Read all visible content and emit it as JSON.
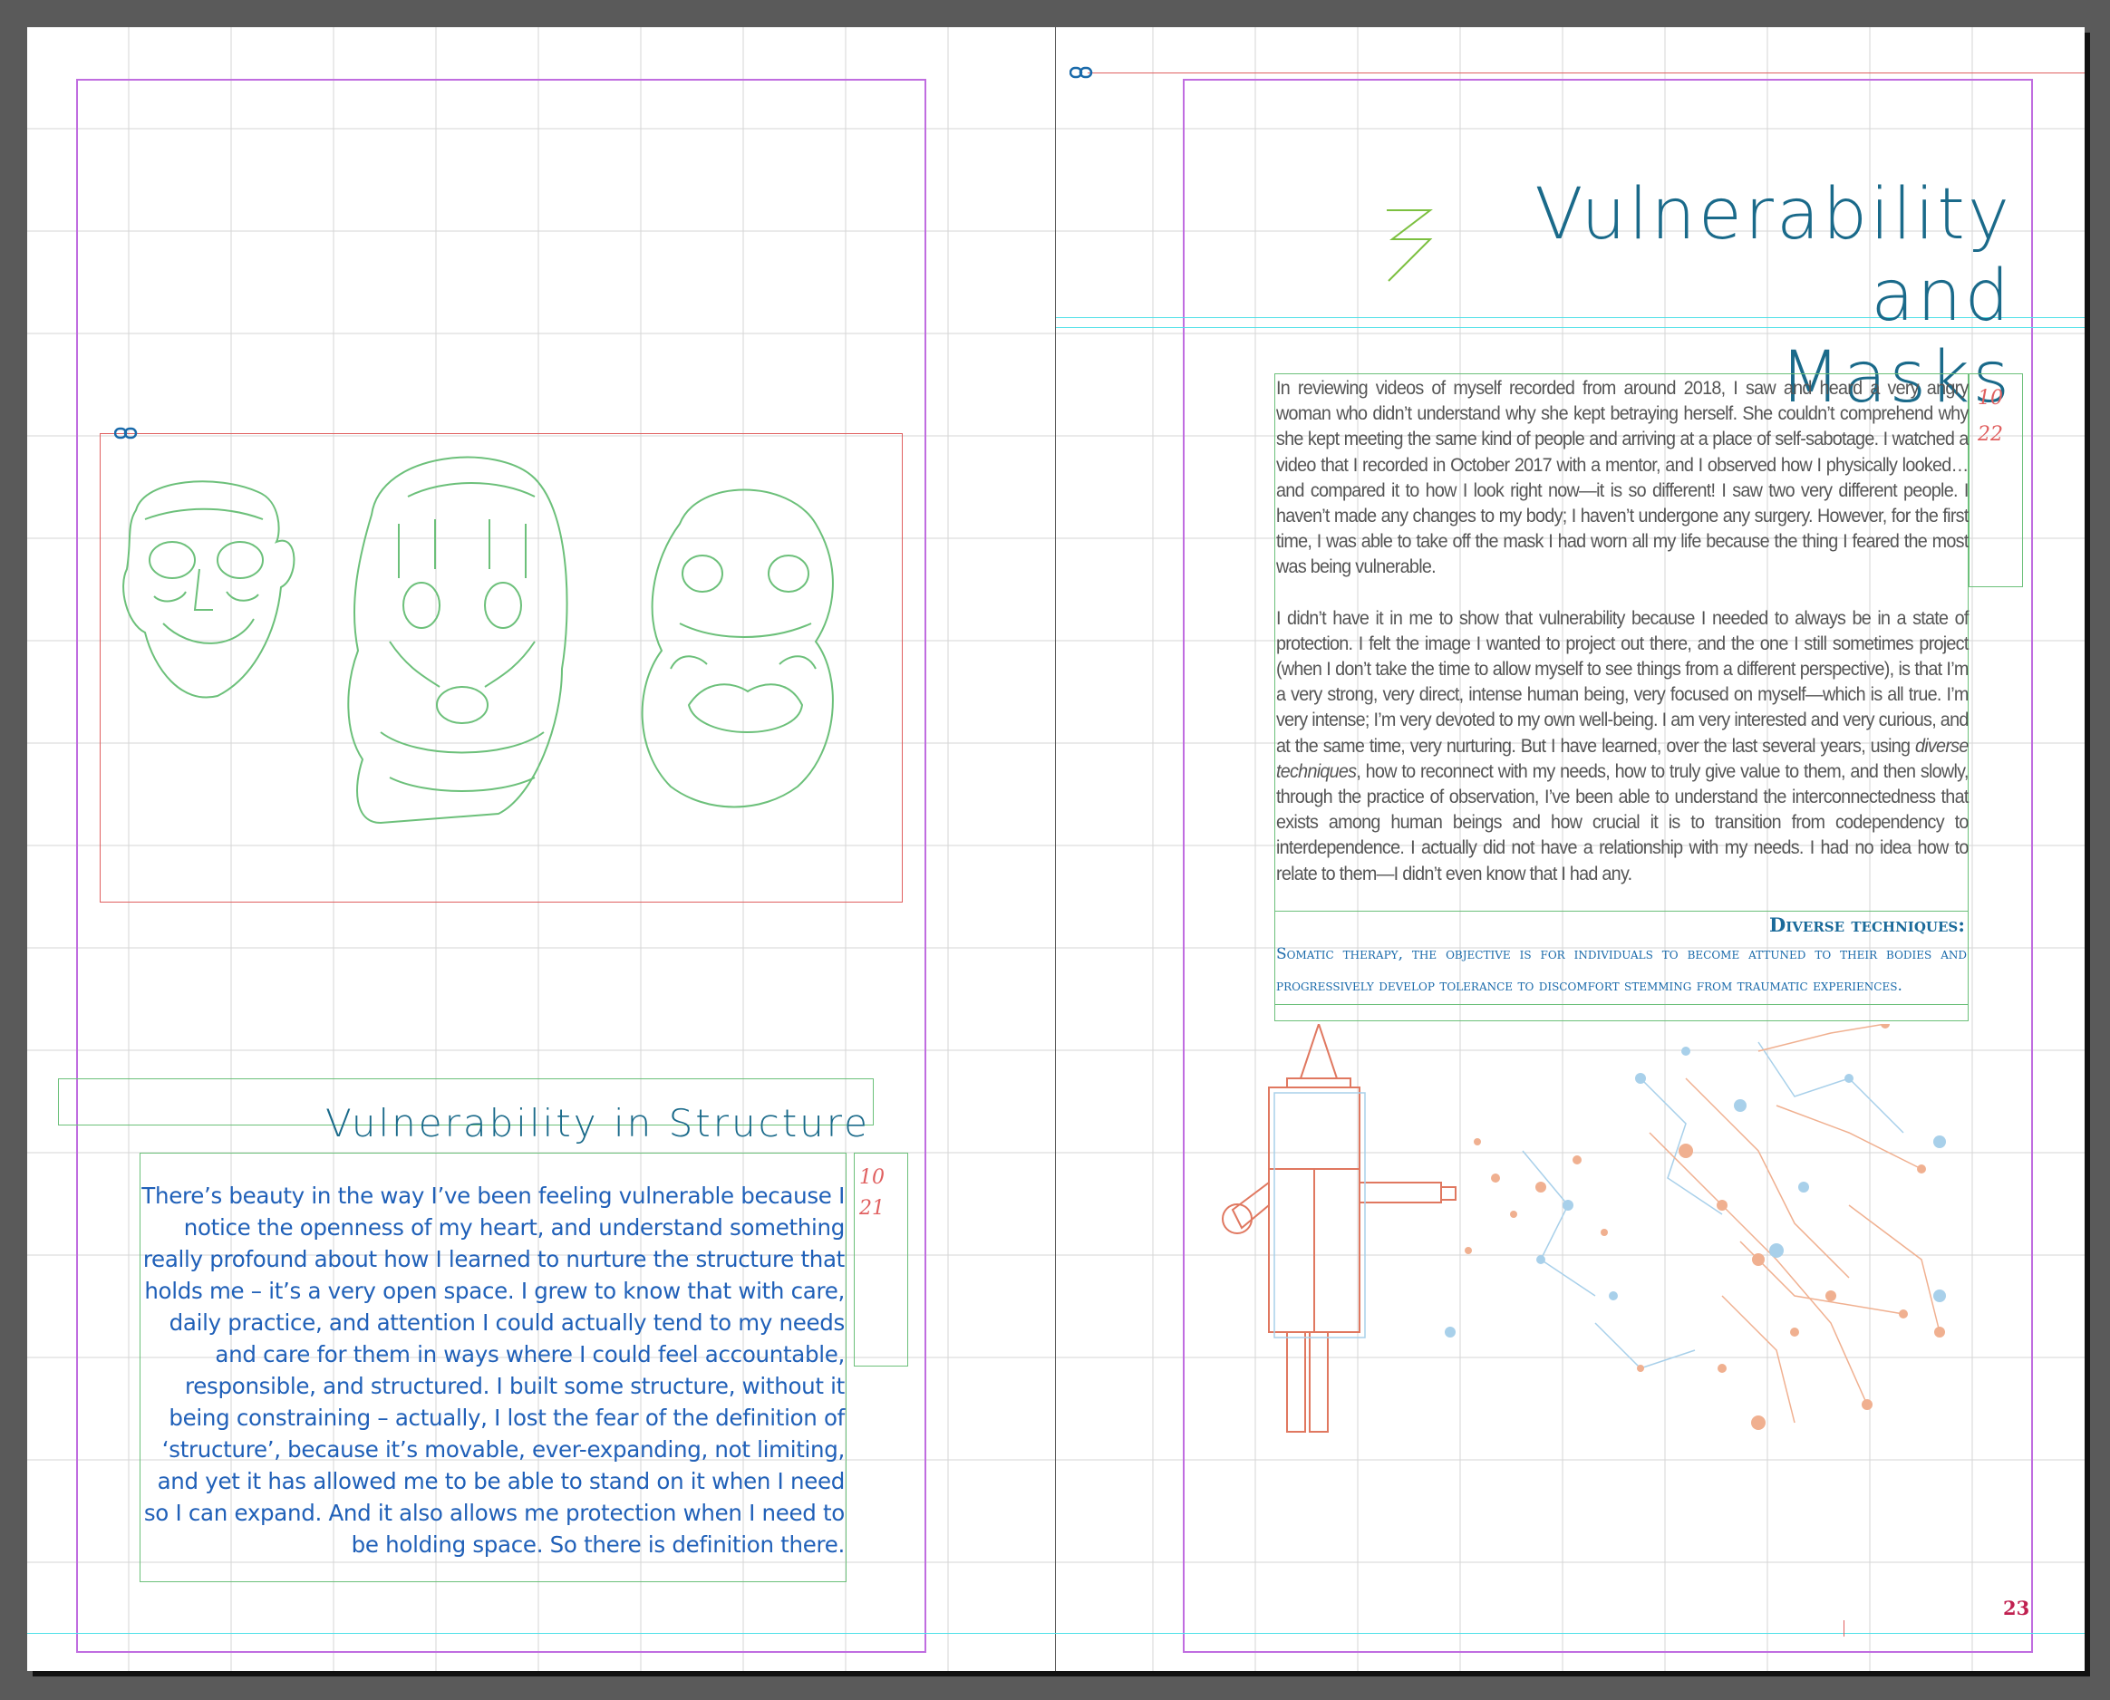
{
  "left_page": {
    "section_heading": "Vulnerability in Structure",
    "body_text": "There’s  beauty in the  way I’ve been feeling vulnerable because I notice the openness of my heart, and understand something really profound about how I learned to nurture the structure that holds me – it’s a very open space.  I grew to know that with care, daily practice, and attention I could actually tend to my needs and care for them in ways where I could feel accountable, responsible, and structured.  I built some structure, without it being constraining – actually, I lost the fear of the  definition of ‘structure’, because it’s movable, ever-expanding, not limiting, and yet it has allowed me to be able to stand on it when I need so I can expand. And it also allows me protection when I need to be holding space. So there is definition there.",
    "notes": [
      "10",
      "21"
    ],
    "image_name": "masks-illustration"
  },
  "right_page": {
    "chapter_title_line1": "Vulnerability",
    "chapter_title_line2": "and",
    "chapter_title_line3": "Masks",
    "chapter_number_glyph": "3",
    "body_paragraph1": "In reviewing videos of myself recorded from around 2018, I saw and heard a very angry woman who didn’t understand why she kept betraying herself. She couldn’t comprehend why she kept meeting the same kind of people and arriving at a place of self-sabotage. I watched a video that I recorded in October 2017 with a mentor, and I observed how I physically looked… and compared it to how I look right now—it is so different! I saw two very different people. I haven’t made any changes to my body; I haven’t undergone any surgery. However, for the first time, I was able to take off the mask I had worn all my life because the thing I feared the most was being vulnerable.",
    "body_paragraph2_part1": "I didn’t have it in me to show that vulnerability because I needed to always be in a state of protection. I felt the image I wanted to project out there, and the one I still sometimes project (when I don’t take the time to allow myself to see things from a different perspective), is that I’m a very strong, very direct, intense human being, very focused on myself—which is all true. I’m very intense; I’m very devoted to my own well-being. I am very interested and very curious, and at the same time, very nurturing. But I have learned, over the last several years, using ",
    "body_paragraph2_italic": "diverse techniques",
    "body_paragraph2_part2": ", how to reconnect with my needs, how to truly give value to them, and then slowly, through the practice of observation, I’ve been able to understand the interconnectedness that exists among human beings and how crucial it is to transition from codependency to interdependence. I actually did not have a relationship with my needs. I had no idea how to relate to them—I didn’t even know that I had any.",
    "notes": [
      "10",
      "22"
    ],
    "sidebar_heading": "Diverse techniques:",
    "sidebar_text": "Somatic therapy, the objective is for individuals to become attuned to their bodies and progressively develop tolerance to discomfort stemming from traumatic experiences.",
    "page_number": "23",
    "image_name": "robot-network-illustration"
  },
  "colors": {
    "title": "#1a6a8a",
    "body_left": "#2060b8",
    "body_right": "#555555",
    "sidebar": "#1a6aaa",
    "notes": "#e06060",
    "page_number": "#c02050",
    "frame_green": "#6cc07a",
    "frame_red": "#e06060",
    "margin": "#c06de0",
    "guide": "#50e0e8",
    "chapter_accent": "#7cc040"
  }
}
